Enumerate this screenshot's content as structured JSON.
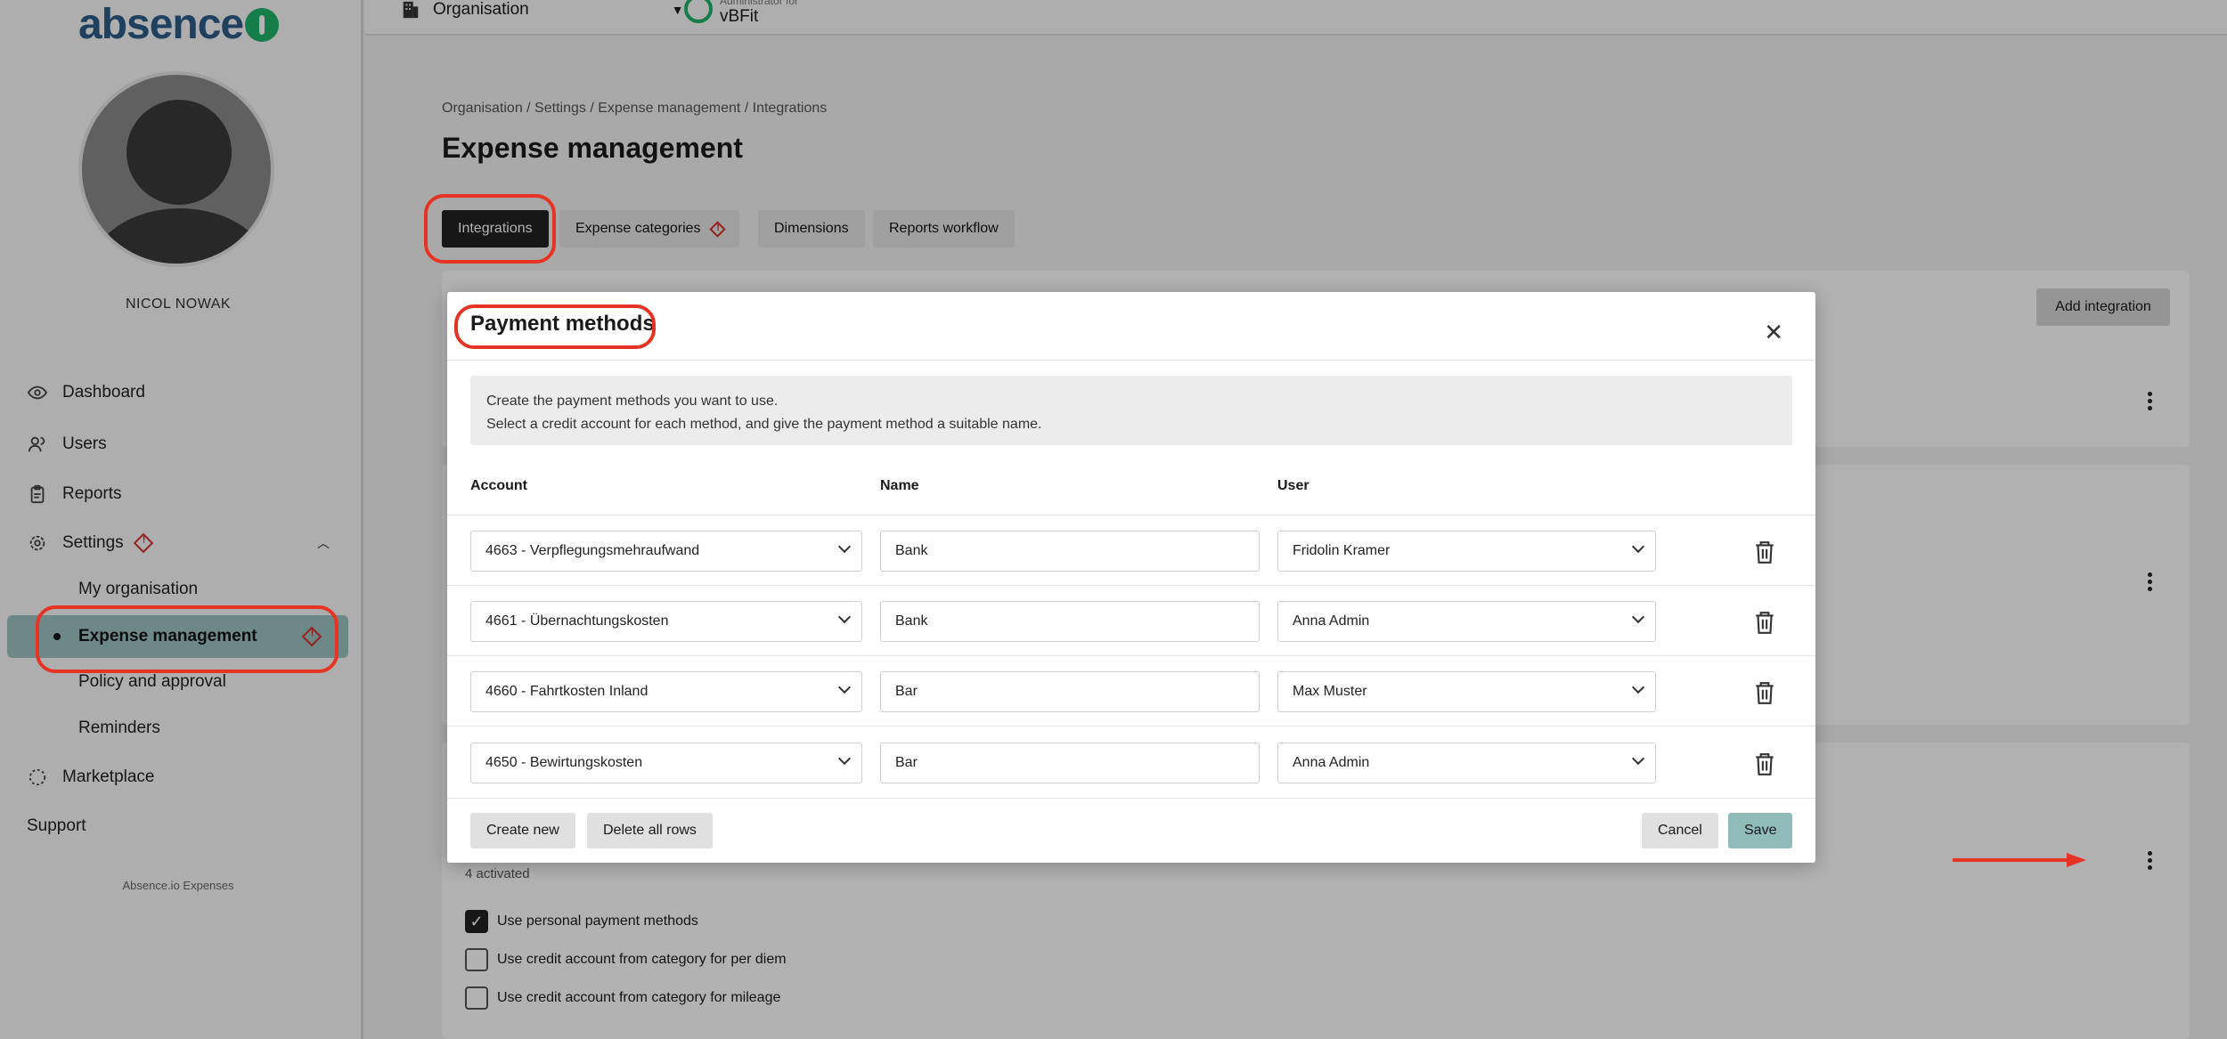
{
  "app": {
    "logo": "absence"
  },
  "sidebar": {
    "user_name": "NICOL NOWAK",
    "items": [
      {
        "label": "Dashboard",
        "icon": "eye-icon"
      },
      {
        "label": "Users",
        "icon": "users-icon"
      },
      {
        "label": "Reports",
        "icon": "clipboard-icon"
      },
      {
        "label": "Settings",
        "icon": "gear-icon"
      },
      {
        "label": "Marketplace",
        "icon": "marketplace-icon"
      },
      {
        "label": "Support",
        "icon": ""
      }
    ],
    "settings_sub": [
      "My organisation",
      "Expense management",
      "Policy and approval",
      "Reminders"
    ],
    "footer": "Absence.io Expenses"
  },
  "topbar": {
    "org_label": "Organisation",
    "admin_small": "Administrator for",
    "admin_name": "vBFit"
  },
  "main": {
    "breadcrumb": "Organisation / Settings / Expense management / Integrations",
    "title": "Expense management",
    "tabs": [
      {
        "label": "Integrations",
        "active": true
      },
      {
        "label": "Expense categories",
        "active": false
      },
      {
        "label": "Dimensions",
        "active": false
      },
      {
        "label": "Reports workflow",
        "active": false
      }
    ],
    "add_integration": "Add integration",
    "activated_text": "4 activated",
    "checkboxes": [
      {
        "label": "Use personal payment methods",
        "checked": true
      },
      {
        "label": "Use credit account from category for per diem",
        "checked": false
      },
      {
        "label": "Use credit account from category for mileage",
        "checked": false
      }
    ]
  },
  "modal": {
    "title": "Payment methods",
    "info_line1": "Create the payment methods you want to use.",
    "info_line2": "Select a credit account for each method, and give the payment method a suitable name.",
    "columns": {
      "account": "Account",
      "name": "Name",
      "user": "User"
    },
    "rows": [
      {
        "account": "4663 - Verpflegungsmehraufwand",
        "name": "Bank",
        "user": "Fridolin Kramer"
      },
      {
        "account": "4661 - Übernachtungskosten",
        "name": "Bank",
        "user": "Anna Admin"
      },
      {
        "account": "4660 - Fahrtkosten Inland",
        "name": "Bar",
        "user": "Max Muster"
      },
      {
        "account": "4650 - Bewirtungskosten",
        "name": "Bar",
        "user": "Anna Admin"
      }
    ],
    "buttons": {
      "create_new": "Create new",
      "delete_all": "Delete all rows",
      "cancel": "Cancel",
      "save": "Save"
    }
  },
  "colors": {
    "accent": "#1fb36a",
    "save": "#8fbcb8",
    "highlight": "#e63323",
    "active_sub": "#9dc3c0"
  }
}
